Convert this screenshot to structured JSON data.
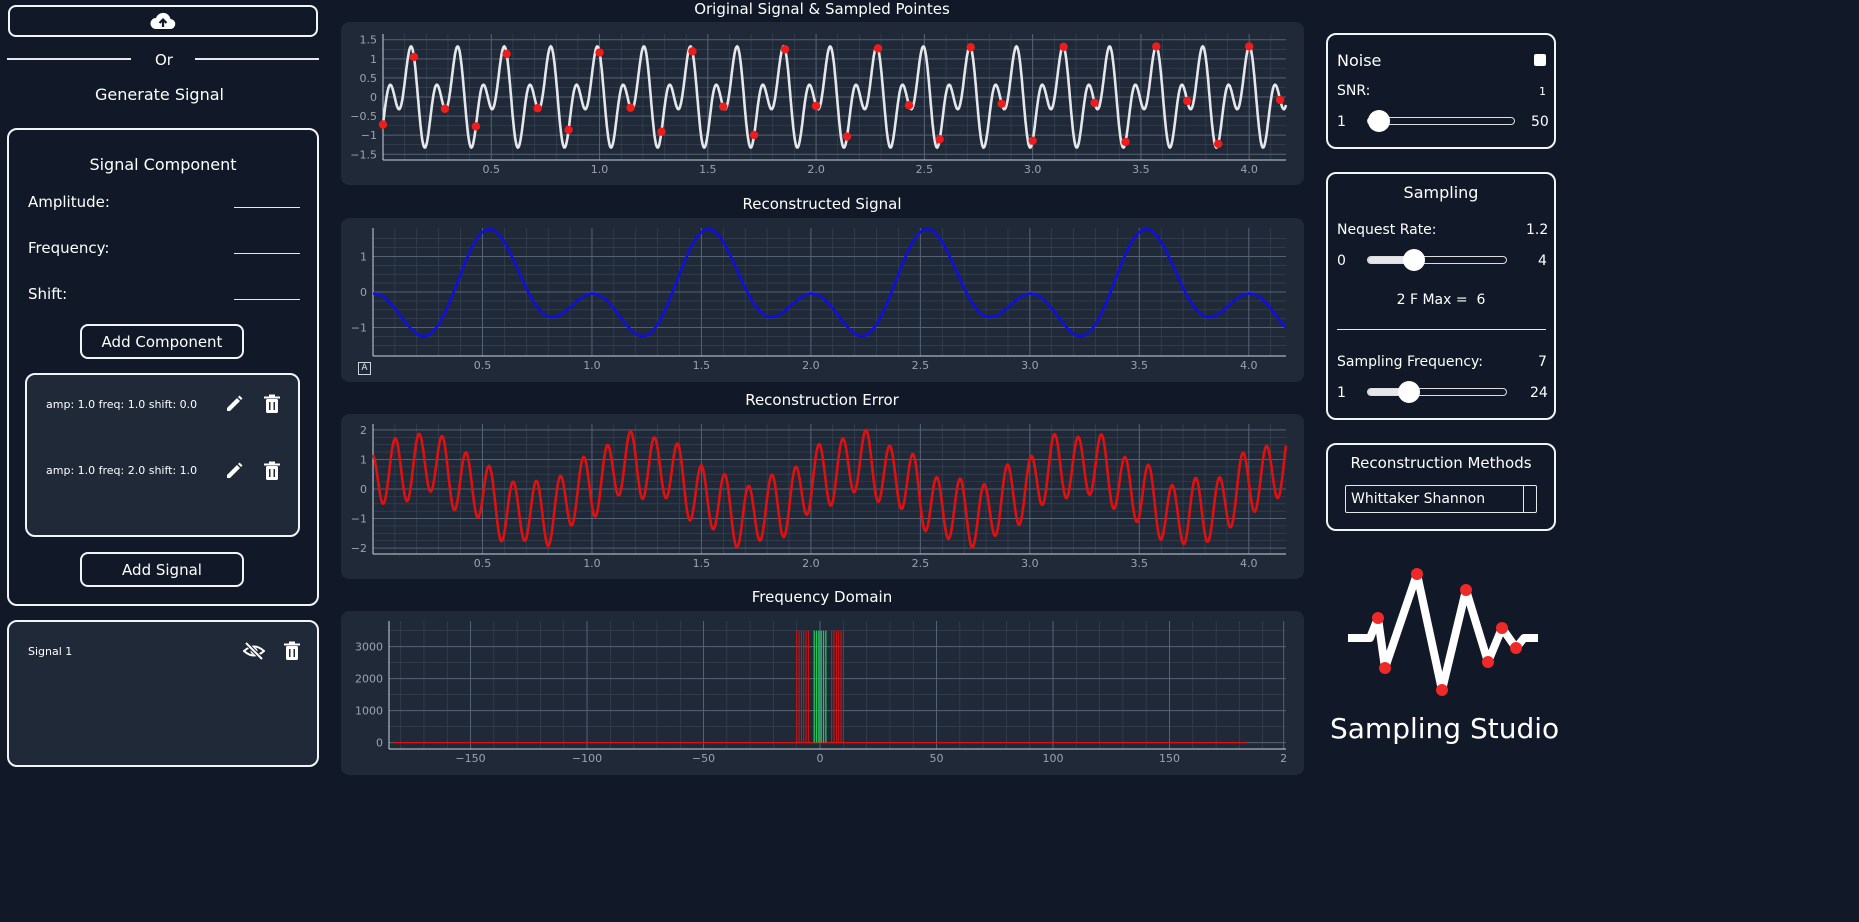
{
  "upload": {
    "icon": "cloud-upload-icon"
  },
  "or_label": "Or",
  "generate_title": "Generate Signal",
  "component": {
    "title": "Signal Component",
    "amplitude_label": "Amplitude:",
    "frequency_label": "Frequency:",
    "shift_label": "Shift:",
    "amplitude_value": "",
    "frequency_value": "",
    "shift_value": "",
    "add_component_label": "Add Component",
    "items": [
      {
        "text": "amp: 1.0 freq: 1.0 shift: 0.0",
        "edit_icon": "pencil-icon",
        "delete_icon": "trash-icon"
      },
      {
        "text": "amp: 1.0 freq: 2.0 shift: 1.0",
        "edit_icon": "pencil-icon",
        "delete_icon": "trash-icon"
      }
    ],
    "add_signal_label": "Add Signal"
  },
  "signals": [
    {
      "name": "Signal 1",
      "visibility_icon": "eye-off-icon",
      "delete_icon": "trash-icon"
    }
  ],
  "noise": {
    "title": "Noise",
    "checked": false,
    "snr_label": "SNR:",
    "snr_value": "1",
    "min": "1",
    "max": "50",
    "level": 0.0
  },
  "sampling": {
    "title": "Sampling",
    "nyquist_label": "Nequest Rate:",
    "nyquist_value": "1.2",
    "nyquist_min": "0",
    "nyquist_max": "4",
    "nyquist_level": 0.3,
    "fmax_text": "2 F Max =  6",
    "freq_label": "Sampling Frequency:",
    "freq_value": "7",
    "freq_min": "1",
    "freq_max": "24",
    "freq_level": 0.26
  },
  "reconstruction": {
    "title": "Reconstruction Methods",
    "selected": "Whittaker Shannon"
  },
  "logo": {
    "text": "Sampling Studio"
  },
  "colors": {
    "panel": "#1f2937",
    "background": "#111827",
    "original": "#e5e7eb",
    "samples": "#ef1c1c",
    "reconstructed": "#1010dd",
    "error": "#e01010",
    "freq_red": "#e01010",
    "freq_green": "#22c55e"
  },
  "charts": {
    "original": {
      "title": "Original Signal & Sampled Pointes",
      "ylabels": [
        "1.5",
        "1",
        "0.5",
        "0",
        "−0.5",
        "−1",
        "−1.5"
      ],
      "xlabels": [
        "0.5",
        "1.0",
        "1.5",
        "2.0",
        "2.5",
        "3.0",
        "3.5",
        "4.0"
      ]
    },
    "reconstructed": {
      "title": "Reconstructed Signal",
      "ylabels": [
        "1",
        "0",
        "−1"
      ],
      "xlabels": [
        "0.5",
        "1.0",
        "1.5",
        "2.0",
        "2.5",
        "3.0",
        "3.5",
        "4.0"
      ],
      "badge": "A"
    },
    "error": {
      "title": "Reconstruction Error",
      "ylabels": [
        "2",
        "1",
        "0",
        "−1",
        "−2"
      ],
      "xlabels": [
        "0.5",
        "1.0",
        "1.5",
        "2.0",
        "2.5",
        "3.0",
        "3.5",
        "4.0"
      ]
    },
    "frequency": {
      "title": "Frequency Domain",
      "ylabels": [
        "3000",
        "2000",
        "1000",
        "0"
      ],
      "xlabels": [
        "−150",
        "−100",
        "−50",
        "0",
        "50",
        "100",
        "150",
        "2"
      ]
    }
  },
  "chart_data": [
    {
      "type": "line",
      "title": "Original Signal & Sampled Pointes",
      "xlim": [
        0,
        4.17
      ],
      "ylim": [
        -1.65,
        1.65
      ],
      "series": [
        {
          "values_formula": "sin(2πt)+sin(4πt+1)+noise"
        }
      ],
      "sample_points_t": [
        0.0,
        0.143,
        0.286,
        0.429,
        0.571,
        0.714,
        0.857,
        1.0,
        1.143,
        1.286,
        1.429,
        1.571,
        1.714,
        1.857,
        2.0,
        2.143,
        2.286,
        2.429,
        2.571,
        2.714,
        2.857,
        3.0,
        3.143,
        3.286,
        3.429,
        3.571,
        3.714,
        3.857,
        4.0,
        4.143
      ]
    },
    {
      "type": "line",
      "title": "Reconstructed Signal",
      "xlim": [
        0,
        4.17
      ],
      "ylim": [
        -1.8,
        1.8
      ]
    },
    {
      "type": "line",
      "title": "Reconstruction Error",
      "xlim": [
        0,
        4.17
      ],
      "ylim": [
        -2.2,
        2.2
      ]
    },
    {
      "type": "bar",
      "title": "Frequency Domain",
      "xlim": [
        -185,
        200
      ],
      "ylim": [
        -200,
        3800
      ]
    }
  ]
}
